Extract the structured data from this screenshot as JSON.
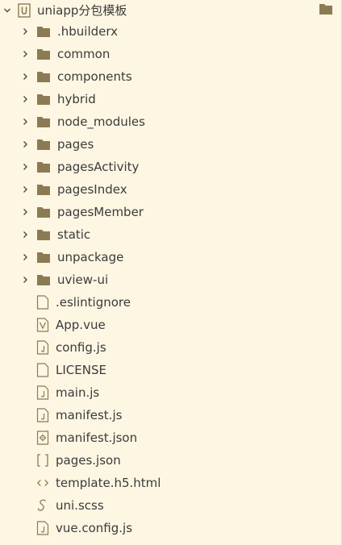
{
  "root": {
    "label": "uniapp分包模板",
    "icon": "project-icon"
  },
  "folders": [
    {
      "label": ".hbuilderx",
      "icon": "folder-icon"
    },
    {
      "label": "common",
      "icon": "folder-icon"
    },
    {
      "label": "components",
      "icon": "folder-icon"
    },
    {
      "label": "hybrid",
      "icon": "folder-icon"
    },
    {
      "label": "node_modules",
      "icon": "folder-icon"
    },
    {
      "label": "pages",
      "icon": "folder-icon"
    },
    {
      "label": "pagesActivity",
      "icon": "folder-icon"
    },
    {
      "label": "pagesIndex",
      "icon": "folder-icon"
    },
    {
      "label": "pagesMember",
      "icon": "folder-icon"
    },
    {
      "label": "static",
      "icon": "folder-icon"
    },
    {
      "label": "unpackage",
      "icon": "folder-icon"
    },
    {
      "label": "uview-ui",
      "icon": "folder-icon"
    }
  ],
  "files": [
    {
      "label": ".eslintignore",
      "icon": "file-icon"
    },
    {
      "label": "App.vue",
      "icon": "vue-file-icon"
    },
    {
      "label": "config.js",
      "icon": "js-file-icon"
    },
    {
      "label": "LICENSE",
      "icon": "file-icon"
    },
    {
      "label": "main.js",
      "icon": "js-file-icon"
    },
    {
      "label": "manifest.js",
      "icon": "js-file-icon"
    },
    {
      "label": "manifest.json",
      "icon": "json-settings-file-icon"
    },
    {
      "label": "pages.json",
      "icon": "json-file-icon"
    },
    {
      "label": "template.h5.html",
      "icon": "html-file-icon"
    },
    {
      "label": "uni.scss",
      "icon": "scss-file-icon"
    },
    {
      "label": "vue.config.js",
      "icon": "js-file-icon"
    }
  ],
  "colors": {
    "background": "#FDF6E3",
    "folder": "#8C7B52",
    "file_outline": "#A8956A",
    "text": "#3b3b3b"
  }
}
